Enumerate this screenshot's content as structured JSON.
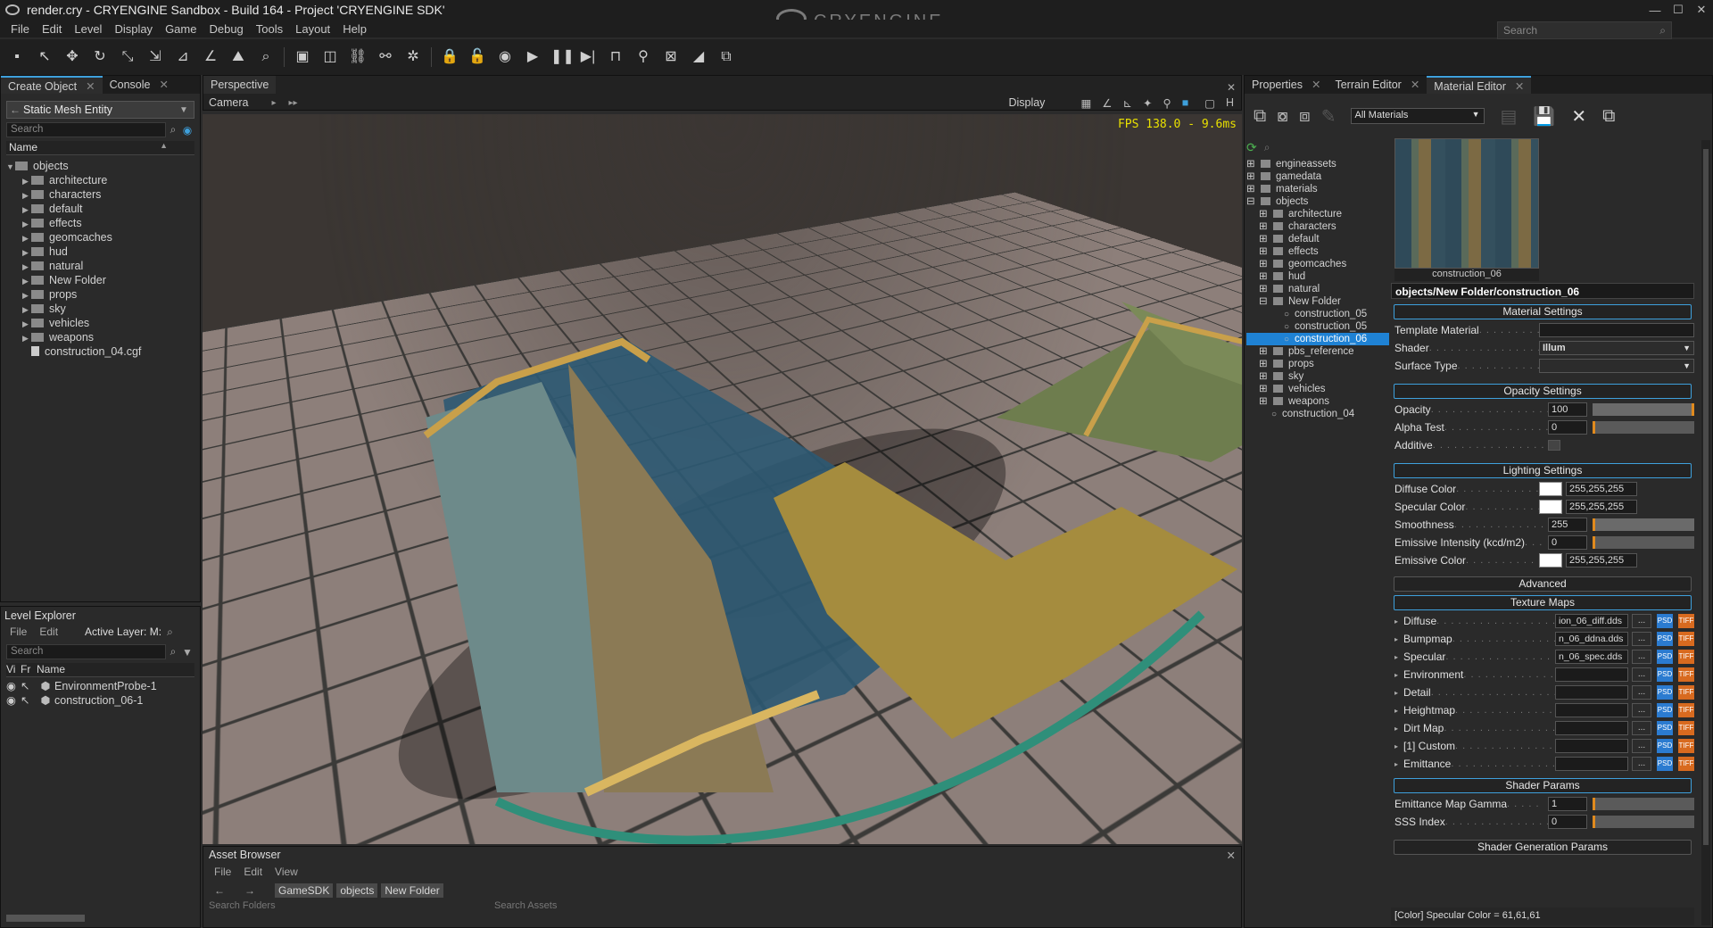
{
  "window": {
    "title": "render.cry - CRYENGINE Sandbox - Build 164 - Project 'CRYENGINE SDK'",
    "brand": "CRYENGINE",
    "search_placeholder": "Search",
    "min": "—",
    "max": "☐",
    "close": "✕"
  },
  "menu": [
    "File",
    "Edit",
    "Level",
    "Display",
    "Game",
    "Debug",
    "Tools",
    "Layout",
    "Help"
  ],
  "left_tabs": {
    "create_object": "Create Object",
    "console": "Console"
  },
  "create_object": {
    "type": "Static Mesh Entity",
    "search_placeholder": "Search",
    "column": "Name",
    "tree": [
      {
        "label": "objects",
        "expanded": true
      },
      {
        "label": "architecture"
      },
      {
        "label": "characters"
      },
      {
        "label": "default"
      },
      {
        "label": "effects"
      },
      {
        "label": "geomcaches"
      },
      {
        "label": "hud"
      },
      {
        "label": "natural"
      },
      {
        "label": "New Folder"
      },
      {
        "label": "props"
      },
      {
        "label": "sky"
      },
      {
        "label": "vehicles"
      },
      {
        "label": "weapons"
      },
      {
        "label": "construction_04.cgf",
        "file": true
      }
    ]
  },
  "level_explorer": {
    "title": "Level Explorer",
    "menu_file": "File",
    "menu_edit": "Edit",
    "active_layer": "Active Layer: M:",
    "search_placeholder": "Search",
    "cols": [
      "Vi",
      "Fr",
      "Name"
    ],
    "rows": [
      "EnvironmentProbe-1",
      "construction_06-1"
    ]
  },
  "viewport": {
    "tab": "Perspective",
    "camera": "Camera",
    "display": "Display",
    "fps": "FPS 138.0 - 9.6ms",
    "h": "H"
  },
  "asset_browser": {
    "title": "Asset Browser",
    "menu": [
      "File",
      "Edit",
      "View"
    ],
    "crumbs": [
      "GameSDK",
      "objects",
      "New Folder"
    ],
    "search_folders": "Search Folders",
    "search_assets": "Search Assets"
  },
  "right_tabs": {
    "properties": "Properties",
    "terrain": "Terrain Editor",
    "material": "Material Editor"
  },
  "material_editor": {
    "filter": "All Materials",
    "preview_label": "construction_06",
    "path": "objects/New Folder/construction_06",
    "tree": [
      {
        "label": "engineassets",
        "level": 0
      },
      {
        "label": "gamedata",
        "level": 0
      },
      {
        "label": "materials",
        "level": 0
      },
      {
        "label": "objects",
        "level": 0,
        "open": true
      },
      {
        "label": "architecture",
        "level": 1
      },
      {
        "label": "characters",
        "level": 1
      },
      {
        "label": "default",
        "level": 1
      },
      {
        "label": "effects",
        "level": 1
      },
      {
        "label": "geomcaches",
        "level": 1
      },
      {
        "label": "hud",
        "level": 1
      },
      {
        "label": "natural",
        "level": 1
      },
      {
        "label": "New Folder",
        "level": 1,
        "open": true
      },
      {
        "label": "construction_05",
        "level": 2,
        "mat": true
      },
      {
        "label": "construction_05",
        "level": 2,
        "mat": true
      },
      {
        "label": "construction_06",
        "level": 2,
        "mat": true,
        "sel": true
      },
      {
        "label": "pbs_reference",
        "level": 1
      },
      {
        "label": "props",
        "level": 1
      },
      {
        "label": "sky",
        "level": 1
      },
      {
        "label": "vehicles",
        "level": 1
      },
      {
        "label": "weapons",
        "level": 1
      },
      {
        "label": "construction_04",
        "level": 1,
        "mat": true
      }
    ],
    "material_settings": {
      "title": "Material Settings",
      "template_label": "Template Material",
      "shader_label": "Shader",
      "shader_value": "Illum",
      "surface_label": "Surface Type"
    },
    "opacity": {
      "title": "Opacity Settings",
      "opacity_label": "Opacity",
      "opacity_value": "100",
      "alpha_label": "Alpha Test",
      "alpha_value": "0",
      "additive_label": "Additive"
    },
    "lighting": {
      "title": "Lighting Settings",
      "diffuse_label": "Diffuse Color",
      "diffuse_value": "255,255,255",
      "specular_label": "Specular Color",
      "specular_value": "255,255,255",
      "smooth_label": "Smoothness",
      "smooth_value": "255",
      "emint_label": "Emissive Intensity (kcd/m2)",
      "emint_value": "0",
      "emcol_label": "Emissive Color",
      "emcol_value": "255,255,255"
    },
    "advanced": "Advanced",
    "texture_maps": {
      "title": "Texture Maps",
      "items": [
        {
          "label": "Diffuse",
          "value": "ion_06_diff.dds"
        },
        {
          "label": "Bumpmap",
          "value": "n_06_ddna.dds"
        },
        {
          "label": "Specular",
          "value": "n_06_spec.dds"
        },
        {
          "label": "Environment",
          "value": ""
        },
        {
          "label": "Detail",
          "value": ""
        },
        {
          "label": "Heightmap",
          "value": ""
        },
        {
          "label": "Dirt Map",
          "value": ""
        },
        {
          "label": "[1] Custom",
          "value": ""
        },
        {
          "label": "Emittance",
          "value": ""
        }
      ],
      "browse": "...",
      "psd": "PSD",
      "tif": "TIFF"
    },
    "shader_params": {
      "title": "Shader Params",
      "gamma_label": "Emittance Map Gamma",
      "gamma_value": "1",
      "sss_label": "SSS Index",
      "sss_value": "0"
    },
    "shader_gen": "Shader Generation Params",
    "status": "[Color] Specular Color = 61,61,61"
  }
}
